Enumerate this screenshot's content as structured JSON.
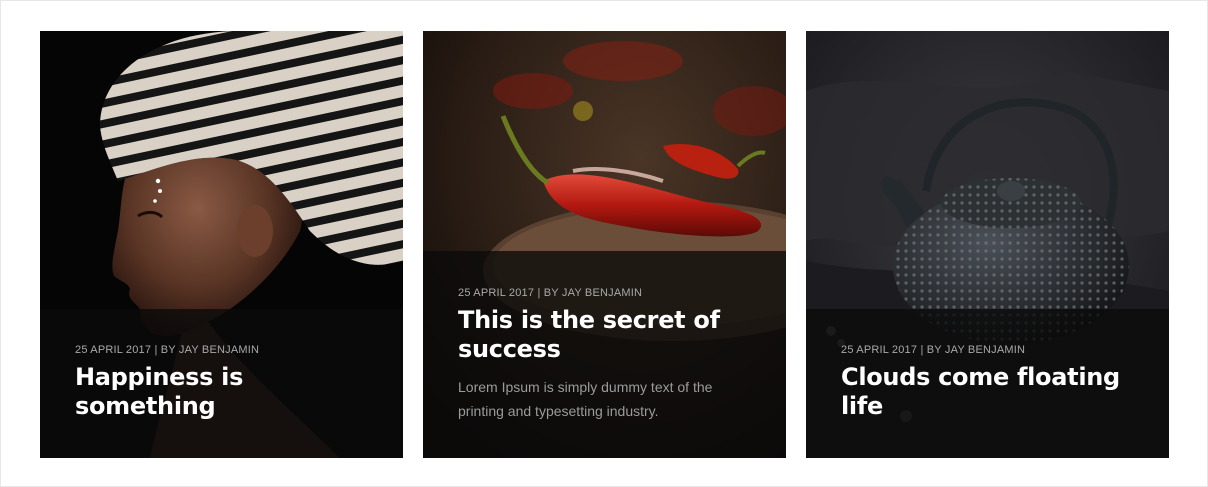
{
  "cards": [
    {
      "image": "woman-striped-headwrap-portrait",
      "meta": "25 APRIL 2017 | BY JAY BENJAMIN",
      "title": "Happiness is something",
      "excerpt": ""
    },
    {
      "image": "red-chili-peppers-on-wooden-board",
      "meta": "25 APRIL 2017 | BY JAY BENJAMIN",
      "title": "This is the secret of success",
      "excerpt": "Lorem Ipsum is simply dummy text of the printing and typesetting industry."
    },
    {
      "image": "cast-iron-teapot-on-dark-cloth",
      "meta": "25 APRIL 2017 | BY JAY BENJAMIN",
      "title": "Clouds come floating life",
      "excerpt": ""
    }
  ],
  "colors": {
    "overlay": "#0a0a0a",
    "title": "#ffffff",
    "meta": "#a9a9a9",
    "excerpt": "#9b9b9b"
  }
}
